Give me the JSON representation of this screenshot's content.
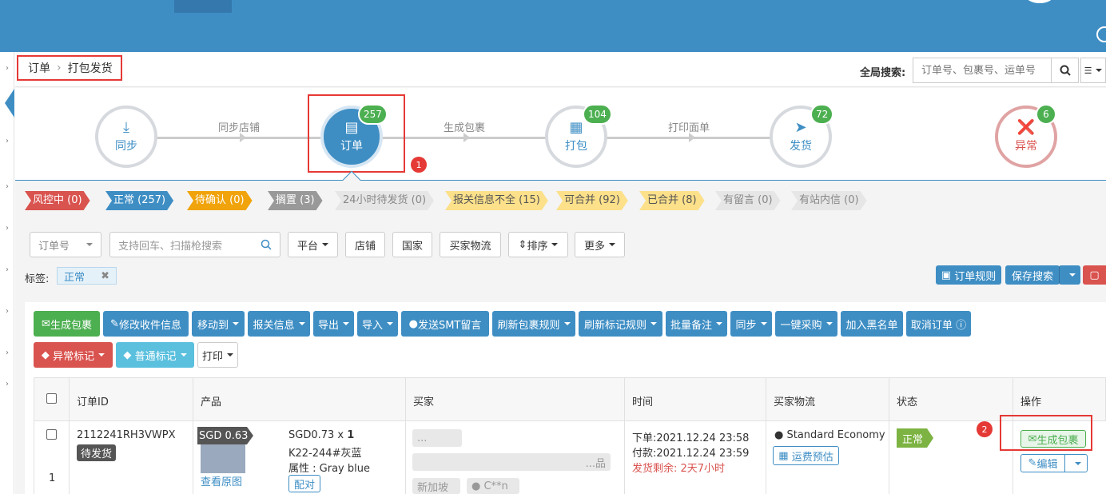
{
  "breadcrumb": {
    "root": "订单",
    "current": "打包发货"
  },
  "global_search": {
    "label": "全局搜索:",
    "placeholder": "订单号、包裹号、运单号"
  },
  "steps": [
    {
      "label": "同步",
      "icon": "download-icon"
    },
    {
      "label": "订单",
      "icon": "order-icon",
      "count": "257"
    },
    {
      "label": "打包",
      "icon": "barcode-icon",
      "count": "104"
    },
    {
      "label": "发货",
      "icon": "paper-plane-icon",
      "count": "72"
    },
    {
      "label": "异常",
      "icon": "eye-slash-icon",
      "count": "6"
    }
  ],
  "step_links": [
    "同步店铺",
    "生成包裹",
    "打印面单"
  ],
  "annotation_markers": [
    "1",
    "2"
  ],
  "status_tabs": [
    {
      "label": "风控中 (0)",
      "color": "#d9534f"
    },
    {
      "label": "正常 (257)",
      "color": "#3e8ec4"
    },
    {
      "label": "待确认 (0)",
      "color": "#f0a30a"
    },
    {
      "label": "搁置 (3)",
      "color": "#999999"
    },
    {
      "label": "24小时待发货 (0)",
      "color": "#e6e6e6"
    },
    {
      "label": "报关信息不全 (15)",
      "color": "#fce08a"
    },
    {
      "label": "可合并 (92)",
      "color": "#fce08a"
    },
    {
      "label": "已合并 (8)",
      "color": "#fce08a"
    },
    {
      "label": "有留言 (0)",
      "color": "#e6e6e6"
    },
    {
      "label": "有站内信 (0)",
      "color": "#e6e6e6"
    }
  ],
  "filters": {
    "field_select": "订单号",
    "search_placeholder": "支持回车、扫描枪搜索",
    "platform": "平台",
    "store": "店铺",
    "country": "国家",
    "buyer_logistics": "买家物流",
    "sort": "排序",
    "more": "更多"
  },
  "tag_filter": {
    "label": "标签:",
    "value": "正常"
  },
  "right_buttons": {
    "order_rules": "订单规则",
    "save_search": "保存搜索"
  },
  "actions": [
    "生成包裹",
    "修改收件信息",
    "移动到",
    "报关信息",
    "导出",
    "导入",
    "发送SMT留言",
    "刷新包裹规则",
    "刷新标记规则",
    "批量备注",
    "同步",
    "一键采购",
    "加入黑名单",
    "取消订单"
  ],
  "actions2": [
    "异常标记",
    "普通标记",
    "打印"
  ],
  "table": {
    "headers": [
      "订单ID",
      "产品",
      "买家",
      "时间",
      "买家物流",
      "状态",
      "操作"
    ],
    "row": {
      "order_id": "2112241RH3VWPX",
      "order_state": "待发货",
      "index": "1",
      "price_badge": "SGD 0.63",
      "view_image": "查看原图",
      "price_qty": "SGD0.73 x ",
      "qty": "1",
      "sku": "K22-244#灰蓝",
      "attr": "属性 : Gray blue",
      "pair": "配对",
      "buyer_name": "...",
      "buyer_note": "...品",
      "buyer_country": "新加坡",
      "buyer_user": "C**n",
      "order_time": "下单:2021.12.24 23:58",
      "pay_time": "付款:2021.12.24 23:59",
      "ship_remaining": "发货剩余: 2天7小时",
      "logistics": "Standard Economy",
      "freight_estimate": "运费预估",
      "status": "正常",
      "op_generate": "生成包裹",
      "op_edit": "编辑"
    }
  }
}
